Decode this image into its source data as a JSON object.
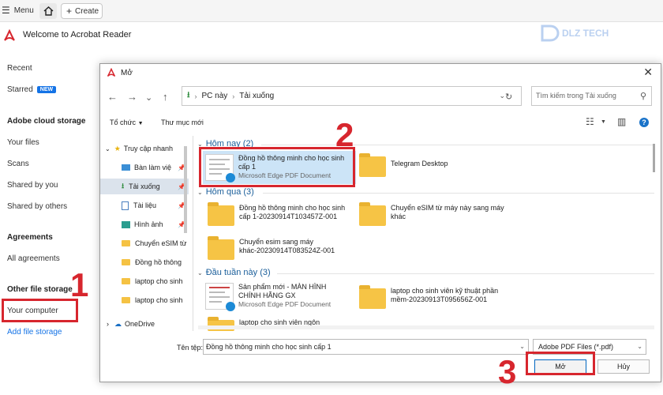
{
  "topbar": {
    "menu_label": "Menu",
    "create_label": "Create"
  },
  "app": {
    "title": "Welcome to Acrobat Reader",
    "watermark": "DLZ TECH"
  },
  "sidebar": {
    "recent": "Recent",
    "starred": "Starred",
    "new_badge": "NEW",
    "cloud_head": "Adobe cloud storage",
    "your_files": "Your files",
    "scans": "Scans",
    "shared_by_you": "Shared by you",
    "shared_by_others": "Shared by others",
    "agreements_head": "Agreements",
    "all_agreements": "All agreements",
    "other_head": "Other file storage",
    "your_computer": "Your computer",
    "add_storage": "Add file storage"
  },
  "annotations": {
    "step1": "1",
    "step2": "2",
    "step3": "3"
  },
  "dialog": {
    "title": "Mở",
    "address": {
      "root": "PC này",
      "folder": "Tải xuống"
    },
    "search_placeholder": "Tìm kiếm trong Tải xuống",
    "organize_label": "Tổ chức",
    "new_folder_label": "Thư mục mới",
    "nav": [
      {
        "label": "Truy cập nhanh"
      },
      {
        "label": "Bàn làm việ"
      },
      {
        "label": "Tải xuống"
      },
      {
        "label": "Tài liệu"
      },
      {
        "label": "Hình ảnh"
      },
      {
        "label": "Chuyển eSIM từ"
      },
      {
        "label": "Đồng hồ thông"
      },
      {
        "label": "laptop cho sinh"
      },
      {
        "label": "laptop cho sinh"
      },
      {
        "label": "OneDrive"
      }
    ],
    "groups": [
      {
        "label": "Hôm nay (2)"
      },
      {
        "label": "Hôm qua (3)"
      },
      {
        "label": "Đầu tuần này (3)"
      }
    ],
    "files": [
      {
        "name1": "Đồng hồ thông minh cho học sinh",
        "name2": "cấp 1",
        "sub": "Microsoft Edge PDF Document"
      },
      {
        "name1": "Telegram Desktop"
      },
      {
        "name1": "Đồng hồ thông minh cho học sinh",
        "name2": "cấp 1-20230914T103457Z-001"
      },
      {
        "name1": "Chuyển eSIM từ máy này sang máy",
        "name2": "khác"
      },
      {
        "name1": "Chuyển esim sang máy",
        "name2": "khác-20230914T083524Z-001"
      },
      {
        "name1": "Sản phẩm mới - MÀN HÌNH",
        "name2": "CHÍNH HÃNG GX",
        "sub": "Microsoft Edge PDF Document"
      },
      {
        "name1": "laptop cho sinh viên kỹ thuật phần",
        "name2": "mềm-20230913T095656Z-001"
      },
      {
        "name1": "laptop cho sinh viên ngôn"
      }
    ],
    "filename_label": "Tên tệp:",
    "filename_value": "Đồng hồ thông minh cho học sinh cấp 1",
    "filter_value": "Adobe PDF Files (*.pdf)",
    "open_label": "Mở",
    "cancel_label": "Hủy"
  },
  "colors": {
    "accent_red": "#d7262e",
    "selection": "#cce4f7",
    "link_blue": "#1473e6"
  }
}
